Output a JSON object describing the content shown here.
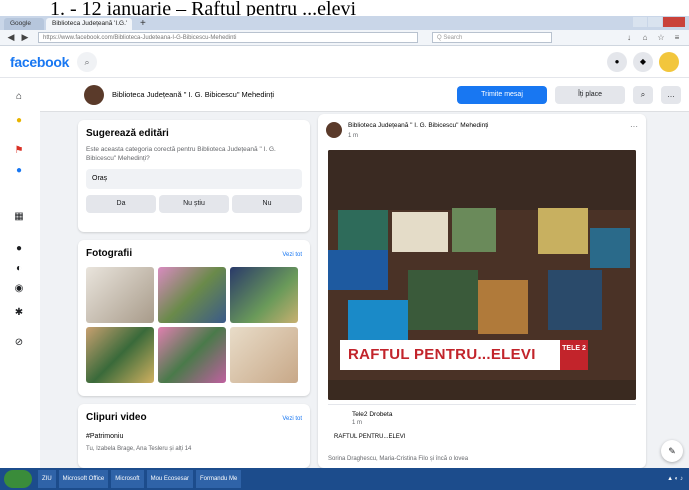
{
  "caption": "1.  - 12 ianuarie – Raftul pentru ...elevi",
  "browser": {
    "tabs": [
      {
        "label": "Google"
      },
      {
        "label": "Biblioteca Județeană 'I.G.'"
      }
    ],
    "url": "https://www.facebook.com/Biblioteca-Judeteana-I-G-Bibicescu-Mehedinti",
    "search_placeholder": "Q Search"
  },
  "facebook": {
    "logo": "facebook",
    "page_name": "Biblioteca Județeană \" I. G. Bibicescu\" Mehedinți",
    "send_message": "Trimite mesaj",
    "like_button": "Îți place"
  },
  "suggest": {
    "title": "Sugerează editări",
    "question": "Este aceasta categoria corectă pentru Biblioteca Județeană \" I. G. Bibicescu\" Mehedinți?",
    "value": "Oraș",
    "buttons": [
      "Da",
      "Nu știu",
      "Nu"
    ]
  },
  "photos": {
    "title": "Fotografii",
    "see_all": "Vezi tot"
  },
  "videos": {
    "title": "Clipuri video",
    "see_all": "Vezi tot",
    "hashtag": "#Patrimoniu",
    "likes": "Tu, Izabela Brage, Ana Tesleru și alți 14"
  },
  "post": {
    "author": "Biblioteca Județeană \" I. G. Bibicescu\" Mehedinți",
    "time": "1 m",
    "banner": "RAFTUL PENTRU...ELEVI",
    "logo_text": "TELE 2",
    "link_name": "Tele2 Drobeta",
    "link_time": "1 m",
    "link_text": "RAFTUL PENTRU...ELEVI",
    "likes": "Sorina Draghescu, Maria-Cristina Filo și încă o lovea"
  },
  "taskbar": {
    "items": [
      "ZIU",
      "Microsoft Office",
      "Microsoft",
      "Mou Ecosesar",
      "Formandu Me"
    ]
  },
  "colors": {
    "accent": "#1877f2",
    "banner_red": "#c2242b"
  }
}
